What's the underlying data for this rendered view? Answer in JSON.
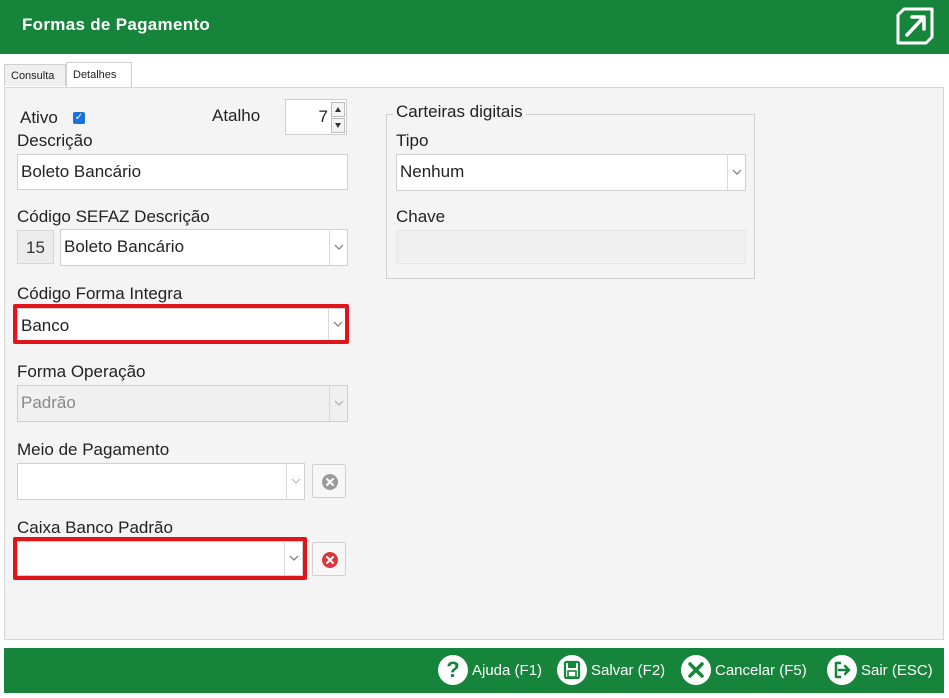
{
  "window": {
    "title": "Formas de Pagamento",
    "logo_icon": "arrow-out-logo"
  },
  "tabs": [
    {
      "label": "Consulta",
      "active": false
    },
    {
      "label": "Detalhes",
      "active": true
    }
  ],
  "form": {
    "ativo_label": "Ativo",
    "ativo_checked": true,
    "atalho_label": "Atalho",
    "atalho_value": "7",
    "descricao_label": "Descrição",
    "descricao_value": "Boleto Bancário",
    "sefaz_label": "Código SEFAZ Descrição",
    "sefaz_code": "15",
    "sefaz_value": "Boleto Bancário",
    "integra_label": "Código Forma Integra",
    "integra_value": "Banco",
    "operacao_label": "Forma Operação",
    "operacao_value": "Padrão",
    "meio_label": "Meio de Pagamento",
    "meio_value": "",
    "caixa_label": "Caixa Banco Padrão",
    "caixa_value": ""
  },
  "carteiras": {
    "legend": "Carteiras digitais",
    "tipo_label": "Tipo",
    "tipo_value": "Nenhum",
    "chave_label": "Chave",
    "chave_value": ""
  },
  "footer": {
    "ajuda": "Ajuda (F1)",
    "salvar": "Salvar (F2)",
    "cancelar": "Cancelar (F5)",
    "sair": "Sair (ESC)"
  },
  "colors": {
    "header": "#16843a",
    "highlight": "#e0141b",
    "checkbox": "#1a73d9"
  }
}
